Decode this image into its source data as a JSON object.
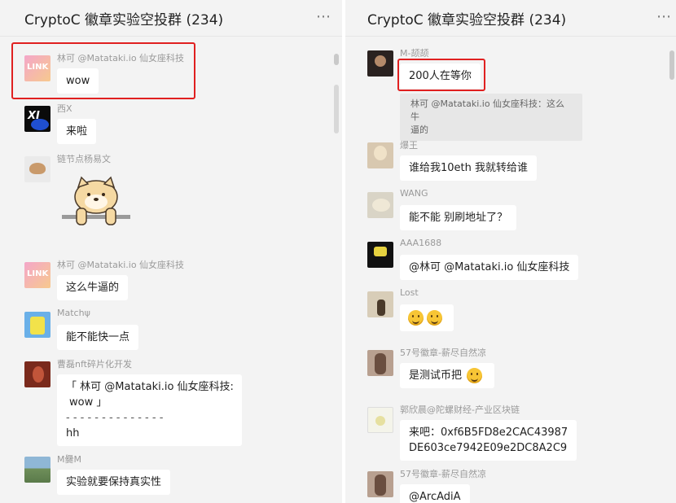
{
  "left": {
    "title": "CryptoC 徽章实验空投群 (234)",
    "more_icon": "⋯",
    "messages": [
      {
        "sender": "林可 @Matataki.io 仙女座科技",
        "text": "wow"
      },
      {
        "sender": "西X",
        "text": "来啦"
      },
      {
        "sender": "链节点杨易文",
        "text": ""
      },
      {
        "sender": "林可 @Matataki.io 仙女座科技",
        "text": "这么牛逼的"
      },
      {
        "sender": "Matchψ",
        "text": "能不能快一点"
      },
      {
        "sender": "曹磊nft碎片化开发",
        "quote_line1": "「 林可 @Matataki.io 仙女座科技:",
        "quote_line2": "wow 」",
        "separator": "- - - - - - - - - - - - - -",
        "text": "hh"
      },
      {
        "sender": "M爨M",
        "text": "实验就要保持真实性"
      }
    ],
    "avatar_texts": {
      "link": "LINK",
      "xi": "XI"
    }
  },
  "right": {
    "title": "CryptoC 徽章实验空投群 (234)",
    "more_icon": "⋯",
    "messages": [
      {
        "sender": "M-颉颉",
        "text": "200人在等你",
        "quote_line1": "林可 @Matataki.io 仙女座科技：这么牛",
        "quote_line2": "逼的"
      },
      {
        "sender": "爆王",
        "text": "谁给我10eth 我就转给谁"
      },
      {
        "sender": "WANG",
        "text": "能不能  别刷地址了？"
      },
      {
        "sender": "AAA1688",
        "text": "@林可 @Matataki.io 仙女座科技"
      },
      {
        "sender": "Lost",
        "text": ""
      },
      {
        "sender": "57号徽章-薪尽自然凉",
        "text": "是测试币把"
      },
      {
        "sender": "郭欣晨@陀螺财经-产业区块链",
        "text_line1": "来吧：0xf6B5FD8e2CAC43987",
        "text_line2": "DE603ce7942E09e2DC8A2C9"
      },
      {
        "sender": "57号徽章-薪尽自然凉",
        "text": "@ArcAdiA"
      }
    ]
  },
  "colors": {
    "highlight": "#e02020",
    "panel_bg": "#f3f3f3",
    "bubble": "#ffffff"
  }
}
